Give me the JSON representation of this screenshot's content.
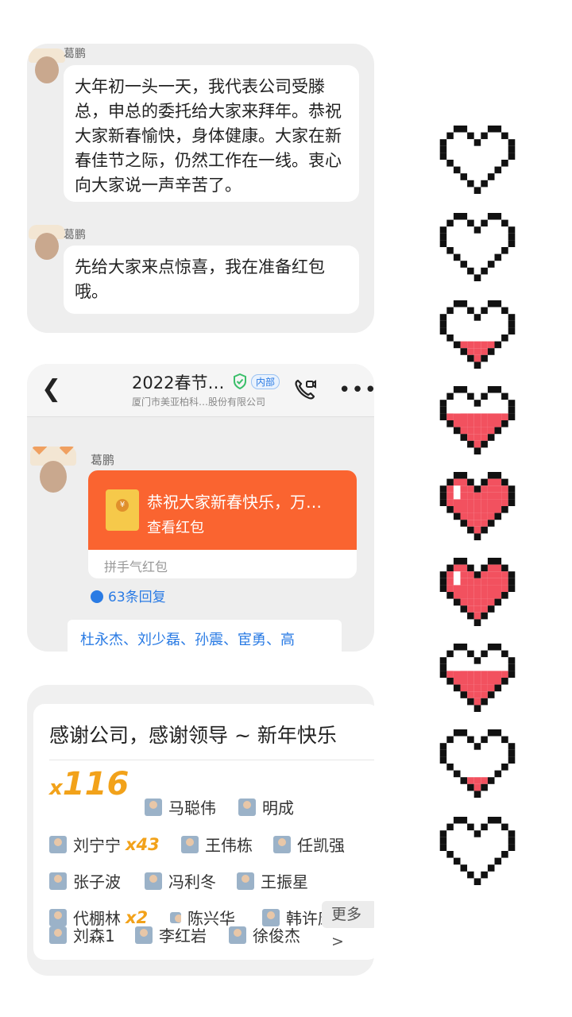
{
  "panel1": {
    "msg1": {
      "sender": "葛鹏",
      "text": "大年初一头一天，我代表公司受滕总，申总的委托给大家来拜年。恭祝大家新春愉快，身体健康。大家在新春佳节之际，仍然工作在一线。衷心向大家说一声辛苦了。"
    },
    "msg2": {
      "sender": "葛鹏",
      "text": "先给大家来点惊喜，我在准备红包哦。"
    }
  },
  "panel2": {
    "title": "2022春节…",
    "tag": "内部",
    "subtitle": "厦门市美亚柏科…股份有限公司",
    "sender": "葛鹏",
    "red_packet": {
      "greeting": "恭祝大家新春快乐，万…",
      "action": "查看红包",
      "seal": "¥",
      "type": "拼手气红包"
    },
    "replies": "63条回复",
    "names": "杜永杰、刘少磊、孙震、宦勇、高"
  },
  "panel3": {
    "thanks": "感谢公司，感谢领导 ~ 新年快乐",
    "x_prefix": "x",
    "total_count": "116",
    "more": "更多 >",
    "people": [
      {
        "name": "马聪伟",
        "mult": ""
      },
      {
        "name": "明成",
        "mult": ""
      },
      {
        "name": "刘宁宁",
        "mult": "x43"
      },
      {
        "name": "王伟栋",
        "mult": ""
      },
      {
        "name": "任凯强",
        "mult": ""
      },
      {
        "name": "张子波",
        "mult": ""
      },
      {
        "name": "冯利冬",
        "mult": ""
      },
      {
        "name": "王振星",
        "mult": ""
      },
      {
        "name": "代棚林",
        "mult": "x2"
      },
      {
        "name": "陈兴华",
        "mult": ""
      },
      {
        "name": "韩许康",
        "mult": ""
      },
      {
        "name": "刘森1",
        "mult": ""
      },
      {
        "name": "李红岩",
        "mult": ""
      },
      {
        "name": "徐俊杰",
        "mult": ""
      }
    ]
  },
  "hearts": {
    "fill_levels": [
      0,
      0.12,
      0.35,
      0.6,
      1,
      1,
      0.6,
      0.3,
      0
    ],
    "fill_color": "#f2515f"
  }
}
